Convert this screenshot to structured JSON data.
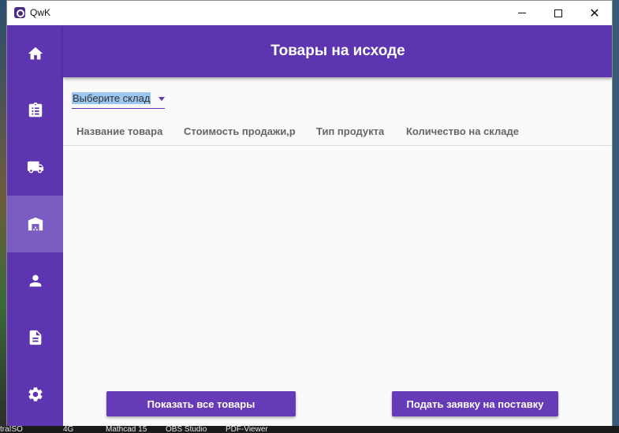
{
  "window": {
    "title": "QwK"
  },
  "header": {
    "title": "Товары на исходе"
  },
  "sidebar": {
    "items": [
      {
        "icon": "home-icon",
        "active": false
      },
      {
        "icon": "clipboard-icon",
        "active": false
      },
      {
        "icon": "truck-icon",
        "active": false
      },
      {
        "icon": "warehouse-icon",
        "active": true
      },
      {
        "icon": "person-icon",
        "active": false
      },
      {
        "icon": "document-icon",
        "active": false
      },
      {
        "icon": "gear-icon",
        "active": false
      }
    ]
  },
  "warehouse_select": {
    "value": "Выберите склад"
  },
  "table": {
    "columns": [
      "Название товара",
      "Стоимость продажи,р",
      "Тип продукта",
      "Количество на складе"
    ],
    "rows": []
  },
  "actions": {
    "show_all_label": "Показать все товары",
    "request_label": "Подать заявку на поставку"
  },
  "taskbar": {
    "labels": [
      "traISO",
      "4G",
      "Mathcad 15",
      "OBS Studio",
      "PDF-Viewer"
    ]
  },
  "colors": {
    "accent": "#5e35b1",
    "button": "#673ab7",
    "active_nav": "#7b5cc2",
    "background": "#fafafa"
  }
}
